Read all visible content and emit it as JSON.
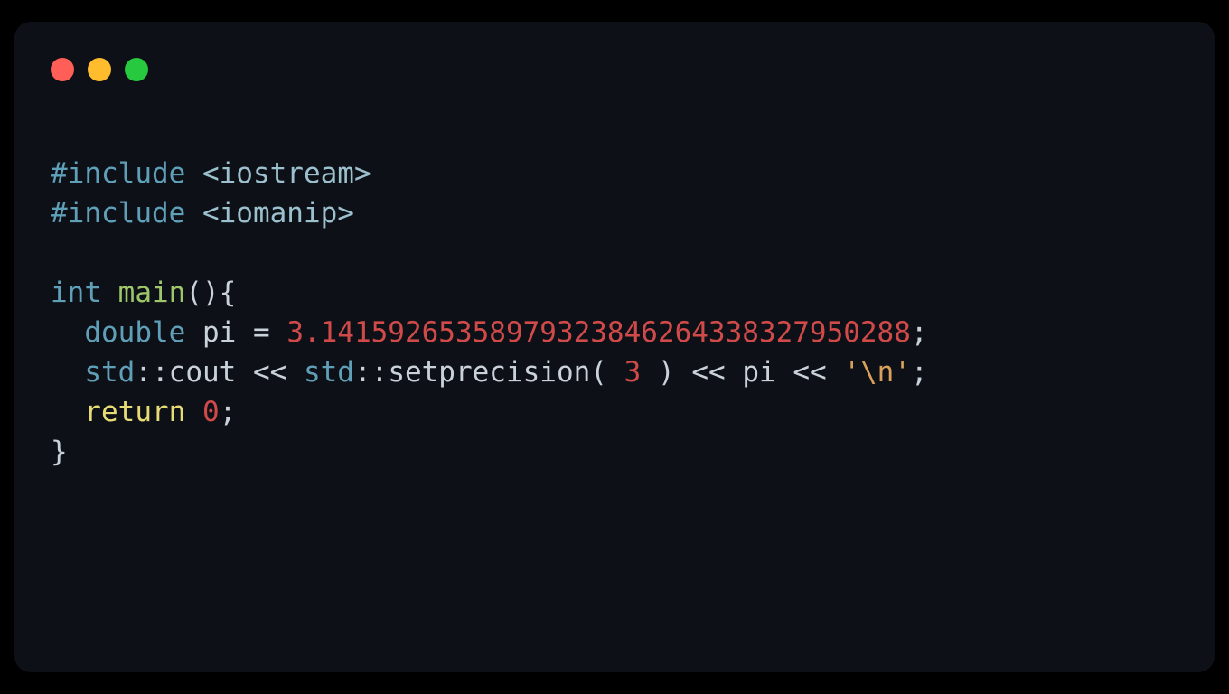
{
  "colors": {
    "red": "#ff5f56",
    "yellow": "#ffbd2e",
    "green": "#27c93f"
  },
  "code": {
    "line1": {
      "directive": "#include ",
      "header": "<iostream>"
    },
    "line2": {
      "directive": "#include ",
      "header": "<iomanip>"
    },
    "line3": "",
    "line4": {
      "type": "int ",
      "func": "main",
      "parens": "(){"
    },
    "line5": {
      "indent": "  ",
      "type": "double",
      "sp1": " ",
      "var": "pi",
      "sp2": " ",
      "eq": "=",
      "sp3": " ",
      "num": "3.14159265358979323846264338327950288",
      "semi": ";"
    },
    "line6": {
      "indent": "  ",
      "std1": "std",
      "cc1": "::",
      "cout": "cout",
      "sp1": " ",
      "op1": "<<",
      "sp2": " ",
      "std2": "std",
      "cc2": "::",
      "setp": "setprecision",
      "lp": "(",
      "sp3": " ",
      "num": "3",
      "sp4": " ",
      "rp": ")",
      "sp5": " ",
      "op2": "<<",
      "sp6": " ",
      "pi": "pi",
      "sp7": " ",
      "op3": "<<",
      "sp8": " ",
      "str": "'\\n'",
      "semi": ";"
    },
    "line7": {
      "indent": "  ",
      "ret": "return",
      "sp": " ",
      "num": "0",
      "semi": ";"
    },
    "line8": {
      "brace": "}"
    }
  }
}
